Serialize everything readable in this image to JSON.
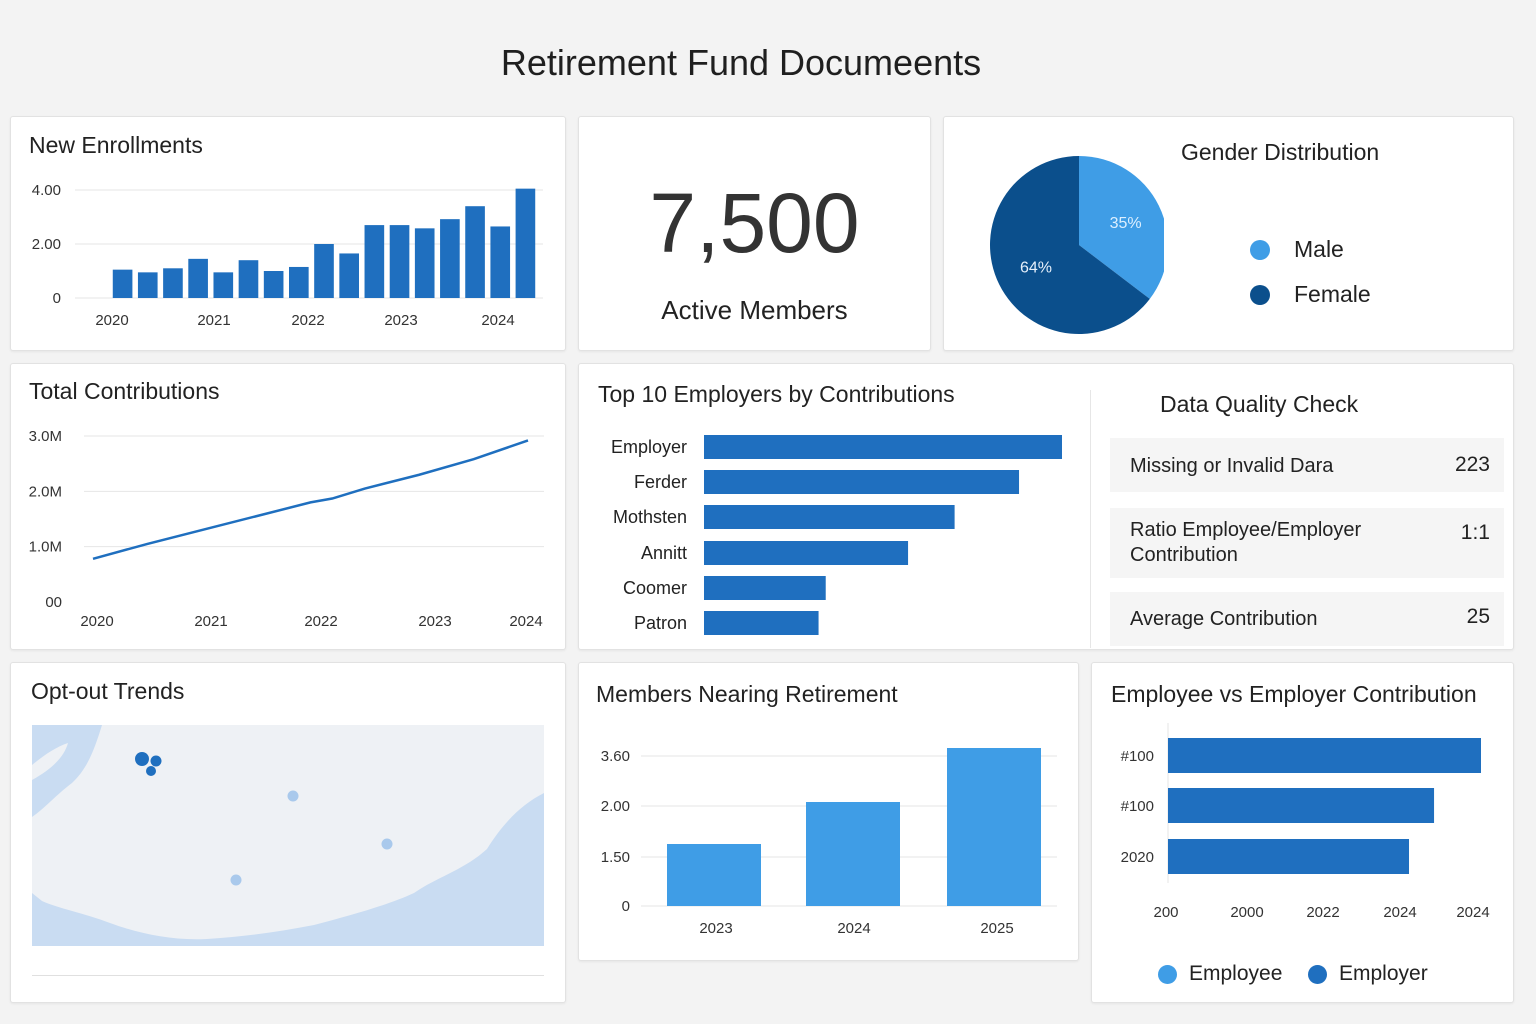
{
  "page_title": "Retirement Fund Documeents",
  "colors": {
    "bar": "#1f6fbf",
    "bar_light": "#3f9de6",
    "male": "#3f9de6",
    "female": "#0b4f8c",
    "map_water": "#c9dcf2",
    "map_land": "#eef1f5",
    "grid": "#e6e6e6"
  },
  "kpi": {
    "value": "7,500",
    "label": "Active Members"
  },
  "gender": {
    "title": "Gender Distribution",
    "legend": [
      "Male",
      "Female"
    ]
  },
  "data_quality": {
    "title": "Data Quality Check",
    "rows": [
      {
        "label": "Missing or Invalid Dara",
        "value": "223"
      },
      {
        "label": "Ratio Employee/Employer Contribution",
        "value": "1:1"
      },
      {
        "label": "Average Contribution",
        "value": "25"
      }
    ]
  },
  "opt_out": {
    "title": "Opt-out Trends",
    "icon": "map-icon"
  },
  "ee_vs_er": {
    "legend": [
      "Employee",
      "Employer"
    ]
  },
  "chart_data": [
    {
      "id": "enrollments",
      "type": "bar",
      "title": "New Enrollments",
      "xlabel": "",
      "ylabel": "",
      "x_tick_labels": [
        "2020",
        "2021",
        "2022",
        "2023",
        "2024"
      ],
      "y_tick_labels": [
        "4.00",
        "2.00",
        "0"
      ],
      "y_ticks": [
        4,
        2,
        0
      ],
      "ylim": [
        0,
        4
      ],
      "values": [
        1.05,
        0.95,
        1.1,
        1.45,
        0.95,
        1.4,
        1.0,
        1.15,
        2.0,
        1.65,
        2.7,
        2.7,
        2.58,
        2.92,
        3.4,
        2.65,
        4.05
      ],
      "grid": true
    },
    {
      "id": "contributions",
      "type": "line",
      "title": "Total Contributions",
      "xlabel": "",
      "ylabel": "",
      "x": [
        2020,
        2020.5,
        2021,
        2021.5,
        2022,
        2022.2,
        2022.5,
        2023,
        2023.5,
        2024
      ],
      "y": [
        0.78,
        1.05,
        1.3,
        1.55,
        1.8,
        1.87,
        2.05,
        2.3,
        2.58,
        2.92
      ],
      "x_tick_labels": [
        "2020",
        "2021",
        "2022",
        "2023",
        "2024"
      ],
      "y_tick_labels": [
        "3.0M",
        "2.0M",
        "1.0M",
        "00"
      ],
      "y_ticks": [
        3,
        2,
        1,
        0
      ],
      "ylim": [
        0,
        3
      ],
      "grid": true
    },
    {
      "id": "gender",
      "type": "pie",
      "title": "Gender Distribution",
      "slices": [
        {
          "label": "Male",
          "value": 35,
          "text": "35%"
        },
        {
          "label": "Female",
          "value": 64,
          "text": "64%"
        }
      ]
    },
    {
      "id": "employers",
      "type": "bar",
      "orientation": "horizontal",
      "title": "Top 10 Employers by Contributions",
      "categories": [
        "Employer",
        "Ferder",
        "Mothsten",
        "Annitt",
        "Coomer",
        "Patron"
      ],
      "values": [
        100,
        88,
        70,
        57,
        34,
        32
      ],
      "xlim": [
        0,
        100
      ]
    },
    {
      "id": "nearing",
      "type": "bar",
      "title": "Members Nearing Retirement",
      "categories": [
        "2023",
        "2024",
        "2025"
      ],
      "values": [
        1.55,
        2.6,
        3.95
      ],
      "y_tick_labels": [
        "3.60",
        "2.00",
        "1.50",
        "0"
      ],
      "grid": true
    },
    {
      "id": "ee_er",
      "type": "bar",
      "orientation": "horizontal",
      "title": "Employee vs Employer Contribution",
      "categories": [
        "#100",
        "#100",
        "2020"
      ],
      "values": [
        100,
        85,
        77
      ],
      "x_tick_labels": [
        "200",
        "2000",
        "2022",
        "2024",
        "2024"
      ],
      "legend": [
        "Employee",
        "Employer"
      ],
      "legend_position": "bottom"
    },
    {
      "id": "optout_map",
      "type": "scatter",
      "title": "Opt-out Trends",
      "points": [
        {
          "size": 3
        },
        {
          "size": 2
        },
        {
          "size": 2
        },
        {
          "size": 2
        },
        {
          "size": 2
        },
        {
          "size": 2
        }
      ]
    }
  ]
}
